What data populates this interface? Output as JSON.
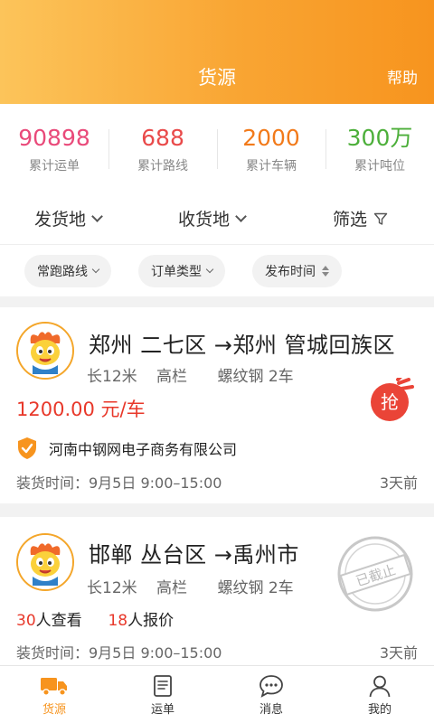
{
  "header": {
    "title": "货源",
    "help": "帮助"
  },
  "stats": [
    {
      "value": "90898",
      "label": "累计运单",
      "color": "#e94a7a"
    },
    {
      "value": "688",
      "label": "累计路线",
      "color": "#e94a4a"
    },
    {
      "value": "2000",
      "label": "累计车辆",
      "color": "#f27a1a"
    },
    {
      "value": "300万",
      "label": "累计吨位",
      "color": "#4caf3a"
    }
  ],
  "filters": {
    "origin": "发货地",
    "destination": "收货地",
    "screen": "筛选"
  },
  "chips": {
    "route": "常跑路线",
    "order_type": "订单类型",
    "publish_time": "发布时间"
  },
  "cards": [
    {
      "route": "郑州 二七区 →郑州 管城回族区",
      "length": "长12米",
      "truck": "高栏",
      "cargo": "螺纹钢 2车",
      "price": "1200.00 元/车",
      "company": "河南中钢网电子商务有限公司",
      "load_time": "装货时间：9月5日 9:00–15:00",
      "ago": "3天前",
      "badge": "抢"
    },
    {
      "route": "邯郸 丛台区 →禹州市",
      "length": "长12米",
      "truck": "高栏",
      "cargo": "螺纹钢 2车",
      "views_count": "30",
      "views_label": "人查看",
      "quotes_count": "18",
      "quotes_label": "人报价",
      "load_time": "装货时间：9月5日 9:00–15:00",
      "ago": "3天前",
      "stamp": "已截止"
    }
  ],
  "tabs": [
    {
      "label": "货源",
      "icon": "truck-icon",
      "active": true
    },
    {
      "label": "运单",
      "icon": "document-icon"
    },
    {
      "label": "消息",
      "icon": "chat-icon"
    },
    {
      "label": "我的",
      "icon": "user-icon"
    }
  ],
  "colors": {
    "accent": "#f7941e",
    "price": "#e8382a"
  }
}
